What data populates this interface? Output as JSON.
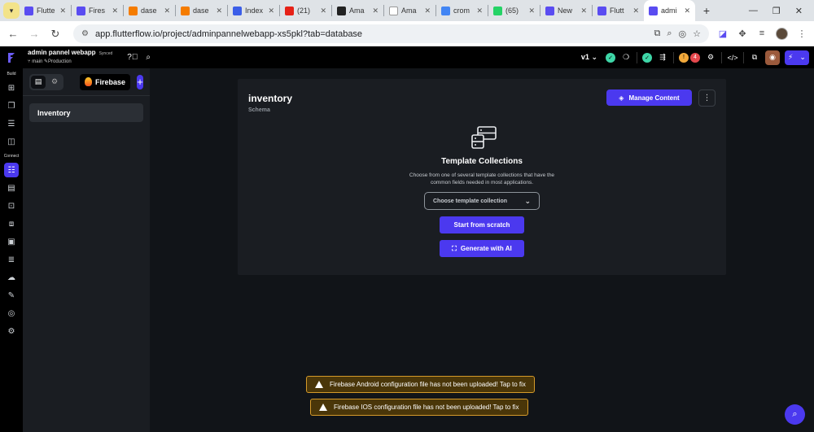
{
  "browser": {
    "tabs": [
      {
        "title": "Flutte",
        "icon": "flutterflow-icon",
        "color": "#5a4cf1"
      },
      {
        "title": "Fires",
        "icon": "flutterflow-icon",
        "color": "#5a4cf1"
      },
      {
        "title": "dase",
        "icon": "firebase-icon",
        "color": "#f57c00"
      },
      {
        "title": "dase",
        "icon": "firebase-icon",
        "color": "#f57c00"
      },
      {
        "title": "Index",
        "icon": "index-icon",
        "color": "#3b5ee8"
      },
      {
        "title": "(21)",
        "icon": "youtube-icon",
        "color": "#e62117"
      },
      {
        "title": "Ama",
        "icon": "amazon-icon",
        "color": "#222222"
      },
      {
        "title": "Ama",
        "icon": "amazon-icon",
        "color": "#ffffff"
      },
      {
        "title": "crom",
        "icon": "google-icon",
        "color": "#4285f4"
      },
      {
        "title": "(65)",
        "icon": "whatsapp-icon",
        "color": "#25d366"
      },
      {
        "title": "New",
        "icon": "flutterflow-icon",
        "color": "#5a4cf1"
      },
      {
        "title": "Flutt",
        "icon": "flutterflow-icon",
        "color": "#5a4cf1"
      },
      {
        "title": "admi",
        "icon": "flutterflow-icon",
        "color": "#5a4cf1",
        "active": true
      }
    ],
    "url": "app.flutterflow.io/project/adminpannelwebapp-xs5pkl?tab=database"
  },
  "topbar": {
    "project_name": "admin pannel webapp",
    "sync_status": "Synced",
    "branch": "main",
    "environment": "Production",
    "version": "v1",
    "badge_count": "4"
  },
  "rail": {
    "build_label": "Build",
    "connect_label": "Connect"
  },
  "panel": {
    "datasource": "Firebase",
    "collections": [
      "Inventory"
    ]
  },
  "main": {
    "title": "inventory",
    "subtitle": "Schema",
    "manage_label": "Manage Content",
    "more_label": "⋮",
    "template_title": "Template Collections",
    "template_desc": "Choose from one of several template collections that have the common fields needed in most applications.",
    "select_placeholder": "Choose template collection",
    "scratch_label": "Start from scratch",
    "ai_label": "Generate with AI"
  },
  "toasts": {
    "android": "Firebase Android configuration file has not been uploaded! Tap to fix",
    "ios": "Firebase IOS configuration file has not been uploaded! Tap to fix"
  },
  "colors": {
    "accent": "#4b39ef",
    "warning_border": "#d59a2a",
    "warning_bg": "#4a3609"
  }
}
